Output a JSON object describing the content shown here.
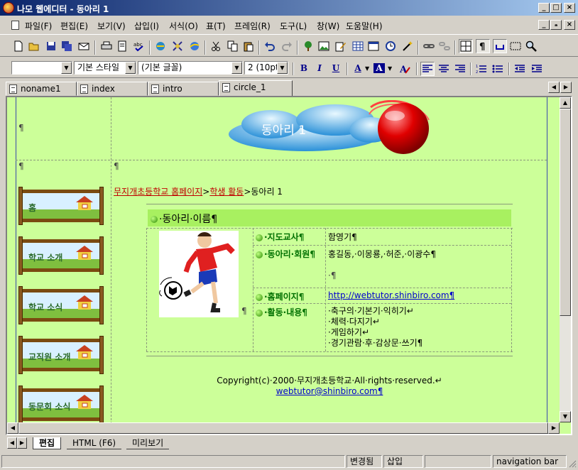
{
  "window": {
    "title": "나모 웹에디터 - 동아리 1",
    "controls": [
      "_",
      "□",
      "×"
    ]
  },
  "menu": [
    "파일(F)",
    "편집(E)",
    "보기(V)",
    "삽입(I)",
    "서식(O)",
    "표(T)",
    "프레임(R)",
    "도구(L)",
    "창(W)",
    "도움말(H)"
  ],
  "menu_controls": [
    "_",
    "ₐ",
    "×"
  ],
  "toolbar_icons": [
    "new-icon",
    "open-icon",
    "save-icon",
    "save-all-icon",
    "mail-icon",
    "print-icon",
    "preview-icon",
    "spell-icon",
    "publish-icon",
    "link-check-icon",
    "browser-icon",
    "cut-icon",
    "copy-icon",
    "paste-icon",
    "undo-icon",
    "redo-icon",
    "tree-icon",
    "image-icon",
    "edit-icon",
    "table-icon",
    "frame-icon",
    "clock-icon",
    "wand-icon",
    "link-icon",
    "unlink-icon",
    "grid-icon",
    "pilcrow-icon",
    "line-icon",
    "marquee-icon",
    "zoom-icon"
  ],
  "format": {
    "style_empty": "",
    "style": "기본 스타일",
    "font": "(기본 글꼴)",
    "size": "2 (10pt)",
    "bold": "B",
    "italic": "I",
    "underline": "U",
    "fontcolor": "A",
    "highlight": "A"
  },
  "tabs": [
    "noname1",
    "index",
    "intro",
    "circle_1"
  ],
  "page": {
    "pilcrow": "¶",
    "banner_text": "동아리 1",
    "breadcrumb": {
      "link1": "무지개초등학교 홈페이지",
      "sep": ">",
      "link2": "학생 활동",
      "current": "동아리 1"
    },
    "nav": [
      "홈",
      "학교 소개",
      "학교 소식",
      "교직원 소개",
      "동문회 소식"
    ],
    "club_name_label": "·동아리·이름¶",
    "rows": [
      {
        "label": "·지도교사¶",
        "value": [
          "함영기¶"
        ]
      },
      {
        "label": "·동아리·회원¶",
        "value": [
          "홍길동,·이몽룡,·허준,·이광수¶",
          "",
          "·¶"
        ]
      },
      {
        "label": "·홈페이지¶",
        "value": [
          "http://webtutor.shinbiro.com¶"
        ]
      },
      {
        "label": "·활동·내용¶",
        "value": [
          "·축구의·기본기·익히기↵",
          "·체력·다지기↵",
          "·게임하기↵",
          "·경기관람·후·감상문·쓰기¶"
        ]
      }
    ],
    "copyright": "Copyright(c)·2000·무지개초등학교·All·rights·reserved.↵",
    "email": "webtutor@shinbiro.com¶"
  },
  "bottom_tabs": [
    "편집",
    "HTML (F6)",
    "미리보기"
  ],
  "status": {
    "s1": "",
    "s2": "변경됨",
    "s3": "삽입",
    "s4": "",
    "s5": "navigation bar"
  },
  "colors": {
    "page_bg": "#ccff99",
    "link": "#c00000",
    "title_bar": "#0a246a"
  }
}
